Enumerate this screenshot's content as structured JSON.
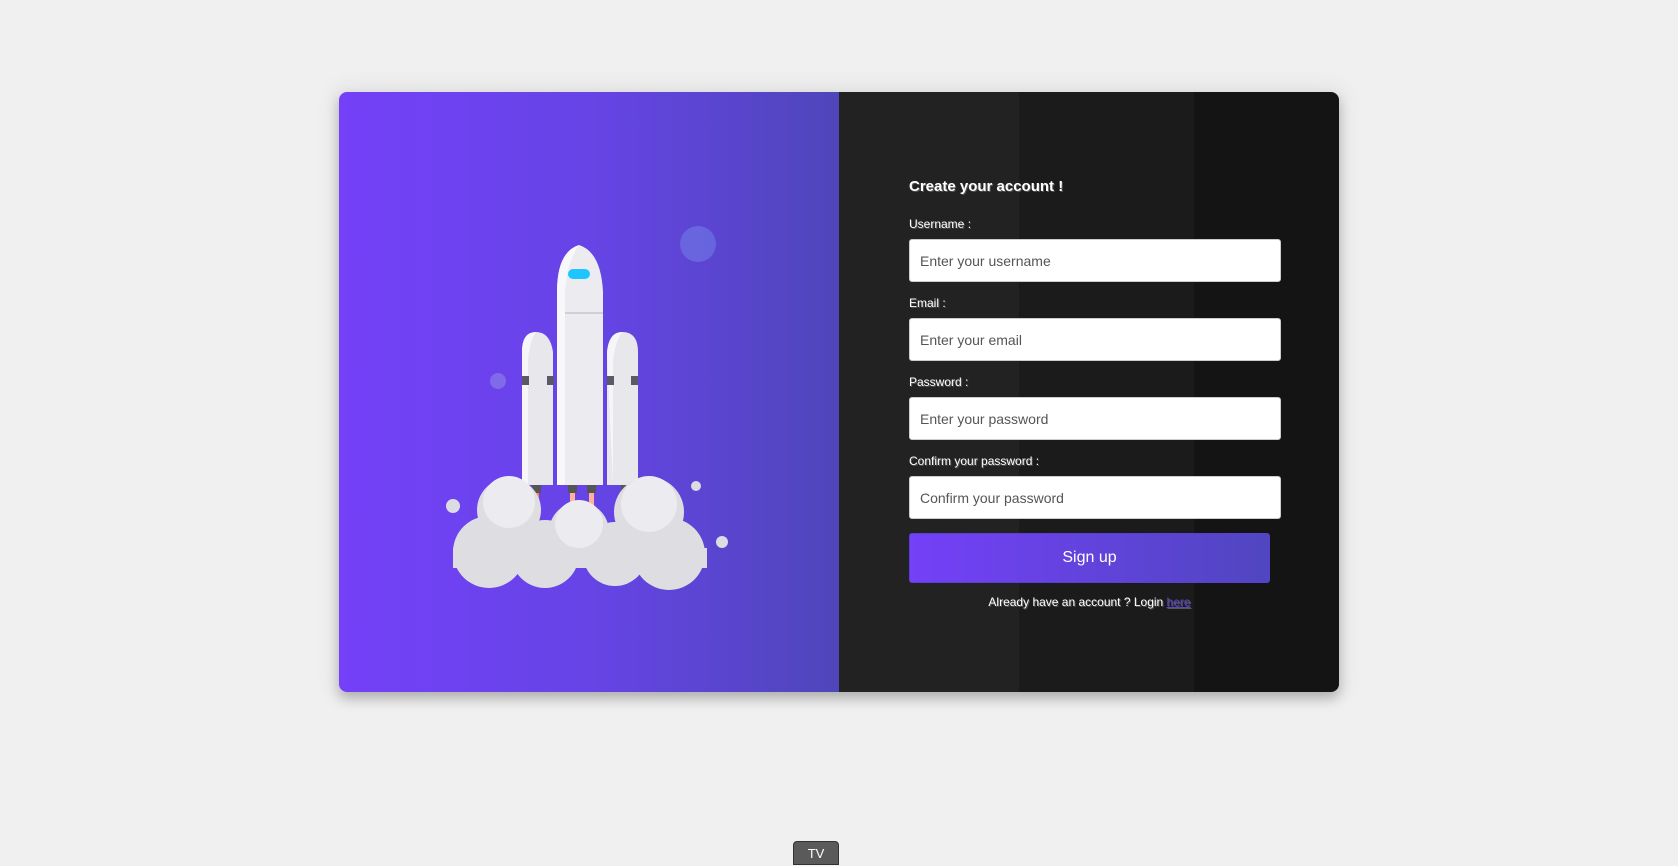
{
  "form": {
    "title": "Create your account !",
    "fields": [
      {
        "label": "Username :",
        "placeholder": "Enter your username",
        "type": "text"
      },
      {
        "label": "Email :",
        "placeholder": "Enter your email",
        "type": "email"
      },
      {
        "label": "Password :",
        "placeholder": "Enter your password",
        "type": "password"
      },
      {
        "label": "Confirm your password :",
        "placeholder": "Confirm your password",
        "type": "password"
      }
    ],
    "submit_label": "Sign up",
    "login_prompt": "Already have an account ? Login ",
    "login_link": "here"
  },
  "badge": "TV",
  "colors": {
    "accent_start": "#7440f8",
    "accent_end": "#5046c0",
    "panel_dark": "#222222",
    "page_bg": "#f0f0f0"
  },
  "illustration": {
    "icon": "rocket-launch-illustration"
  }
}
